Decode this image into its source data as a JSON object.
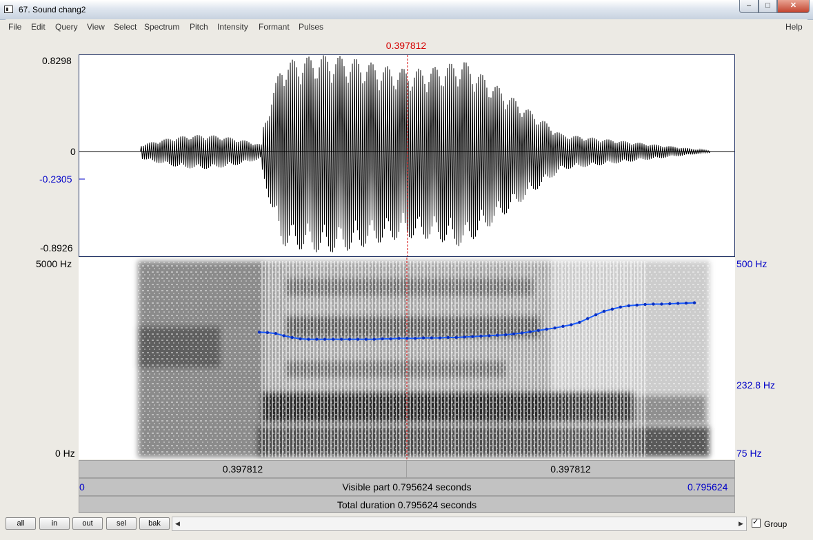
{
  "window": {
    "title": "67. Sound chang2",
    "controls": {
      "minimize": "–",
      "maximize": "□",
      "close": "✕"
    }
  },
  "menu": [
    "File",
    "Edit",
    "Query",
    "View",
    "Select",
    "Spectrum",
    "Pitch",
    "Intensity",
    "Formant",
    "Pulses"
  ],
  "help_label": "Help",
  "cursor_time": "0.397812",
  "waveform": {
    "y_max": "0.8298",
    "y_zero": "0",
    "y_cursor": "-0.2305",
    "y_min": "-0.8926"
  },
  "spectrogram": {
    "freq_max": "5000 Hz",
    "freq_min": "0 Hz",
    "pitch_max": "500 Hz",
    "pitch_current": "232.8 Hz",
    "pitch_min": "75 Hz",
    "pitch_track_hz": [
      248,
      247,
      245,
      240,
      236,
      233,
      232,
      232,
      232,
      232,
      232,
      232,
      232,
      232,
      232,
      233,
      233,
      234,
      234,
      234,
      235,
      235,
      235,
      236,
      236,
      237,
      238,
      239,
      240,
      241,
      242,
      244,
      246,
      249,
      252,
      255,
      258,
      262,
      266,
      272,
      282,
      292,
      302,
      308,
      314,
      318,
      320,
      322,
      323,
      323,
      324,
      325,
      326,
      327
    ]
  },
  "time_bar": {
    "left_segment": "0.397812",
    "right_segment": "0.397812",
    "visible_start": "0",
    "visible_label": "Visible part 0.795624 seconds",
    "visible_end": "0.795624",
    "total_label": "Total duration 0.795624 seconds"
  },
  "bottom_buttons": [
    "all",
    "in",
    "out",
    "sel",
    "bak"
  ],
  "group_label": "Group",
  "colors": {
    "cursor": "#d40000",
    "pitch": "#1a5cff",
    "axis_blue": "#0000c8"
  }
}
